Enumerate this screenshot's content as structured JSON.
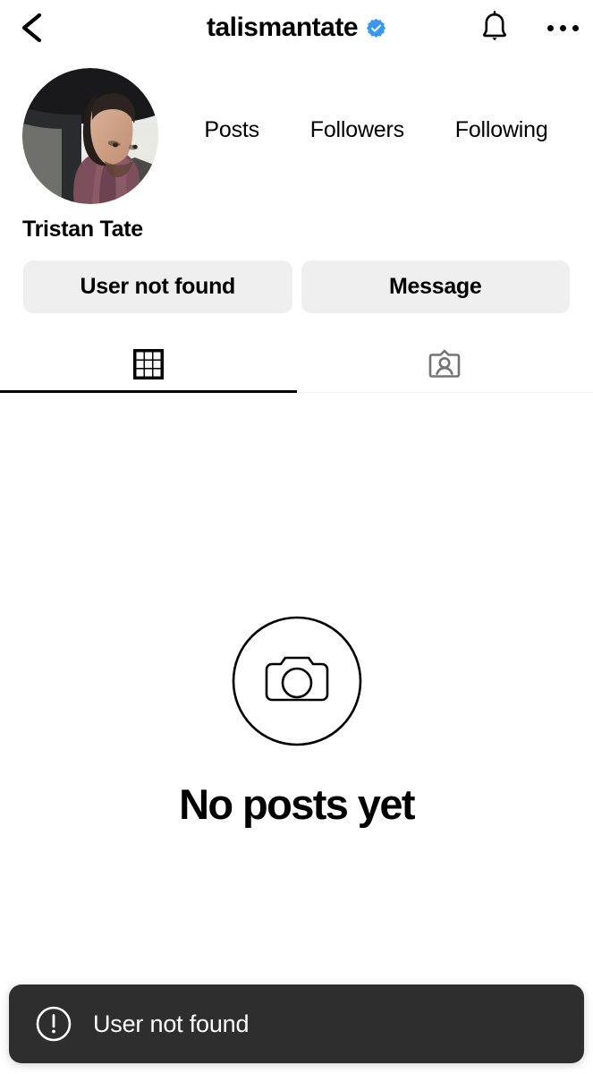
{
  "header": {
    "back_icon": "chevron-left-icon",
    "username": "talismantate",
    "verified_icon": "verified-badge-icon",
    "bell_icon": "bell-icon",
    "more_icon": "more-options-icon",
    "verified_color": "#3897f0"
  },
  "profile": {
    "avatar_alt": "profile-photo",
    "display_name": "Tristan Tate",
    "stats": [
      {
        "label": "Posts",
        "value": ""
      },
      {
        "label": "Followers",
        "value": ""
      },
      {
        "label": "Following",
        "value": ""
      }
    ]
  },
  "actions": {
    "primary_label": "User not found",
    "secondary_label": "Message",
    "button_bg": "#efefef"
  },
  "tabs": [
    {
      "name": "grid",
      "icon": "grid-icon",
      "active": true
    },
    {
      "name": "tagged",
      "icon": "tagged-person-icon",
      "active": false
    }
  ],
  "empty_state": {
    "icon": "camera-circle-icon",
    "title": "No posts yet"
  },
  "toast": {
    "icon": "exclamation-circle-icon",
    "message": "User not found",
    "background": "#2e2e2e"
  }
}
